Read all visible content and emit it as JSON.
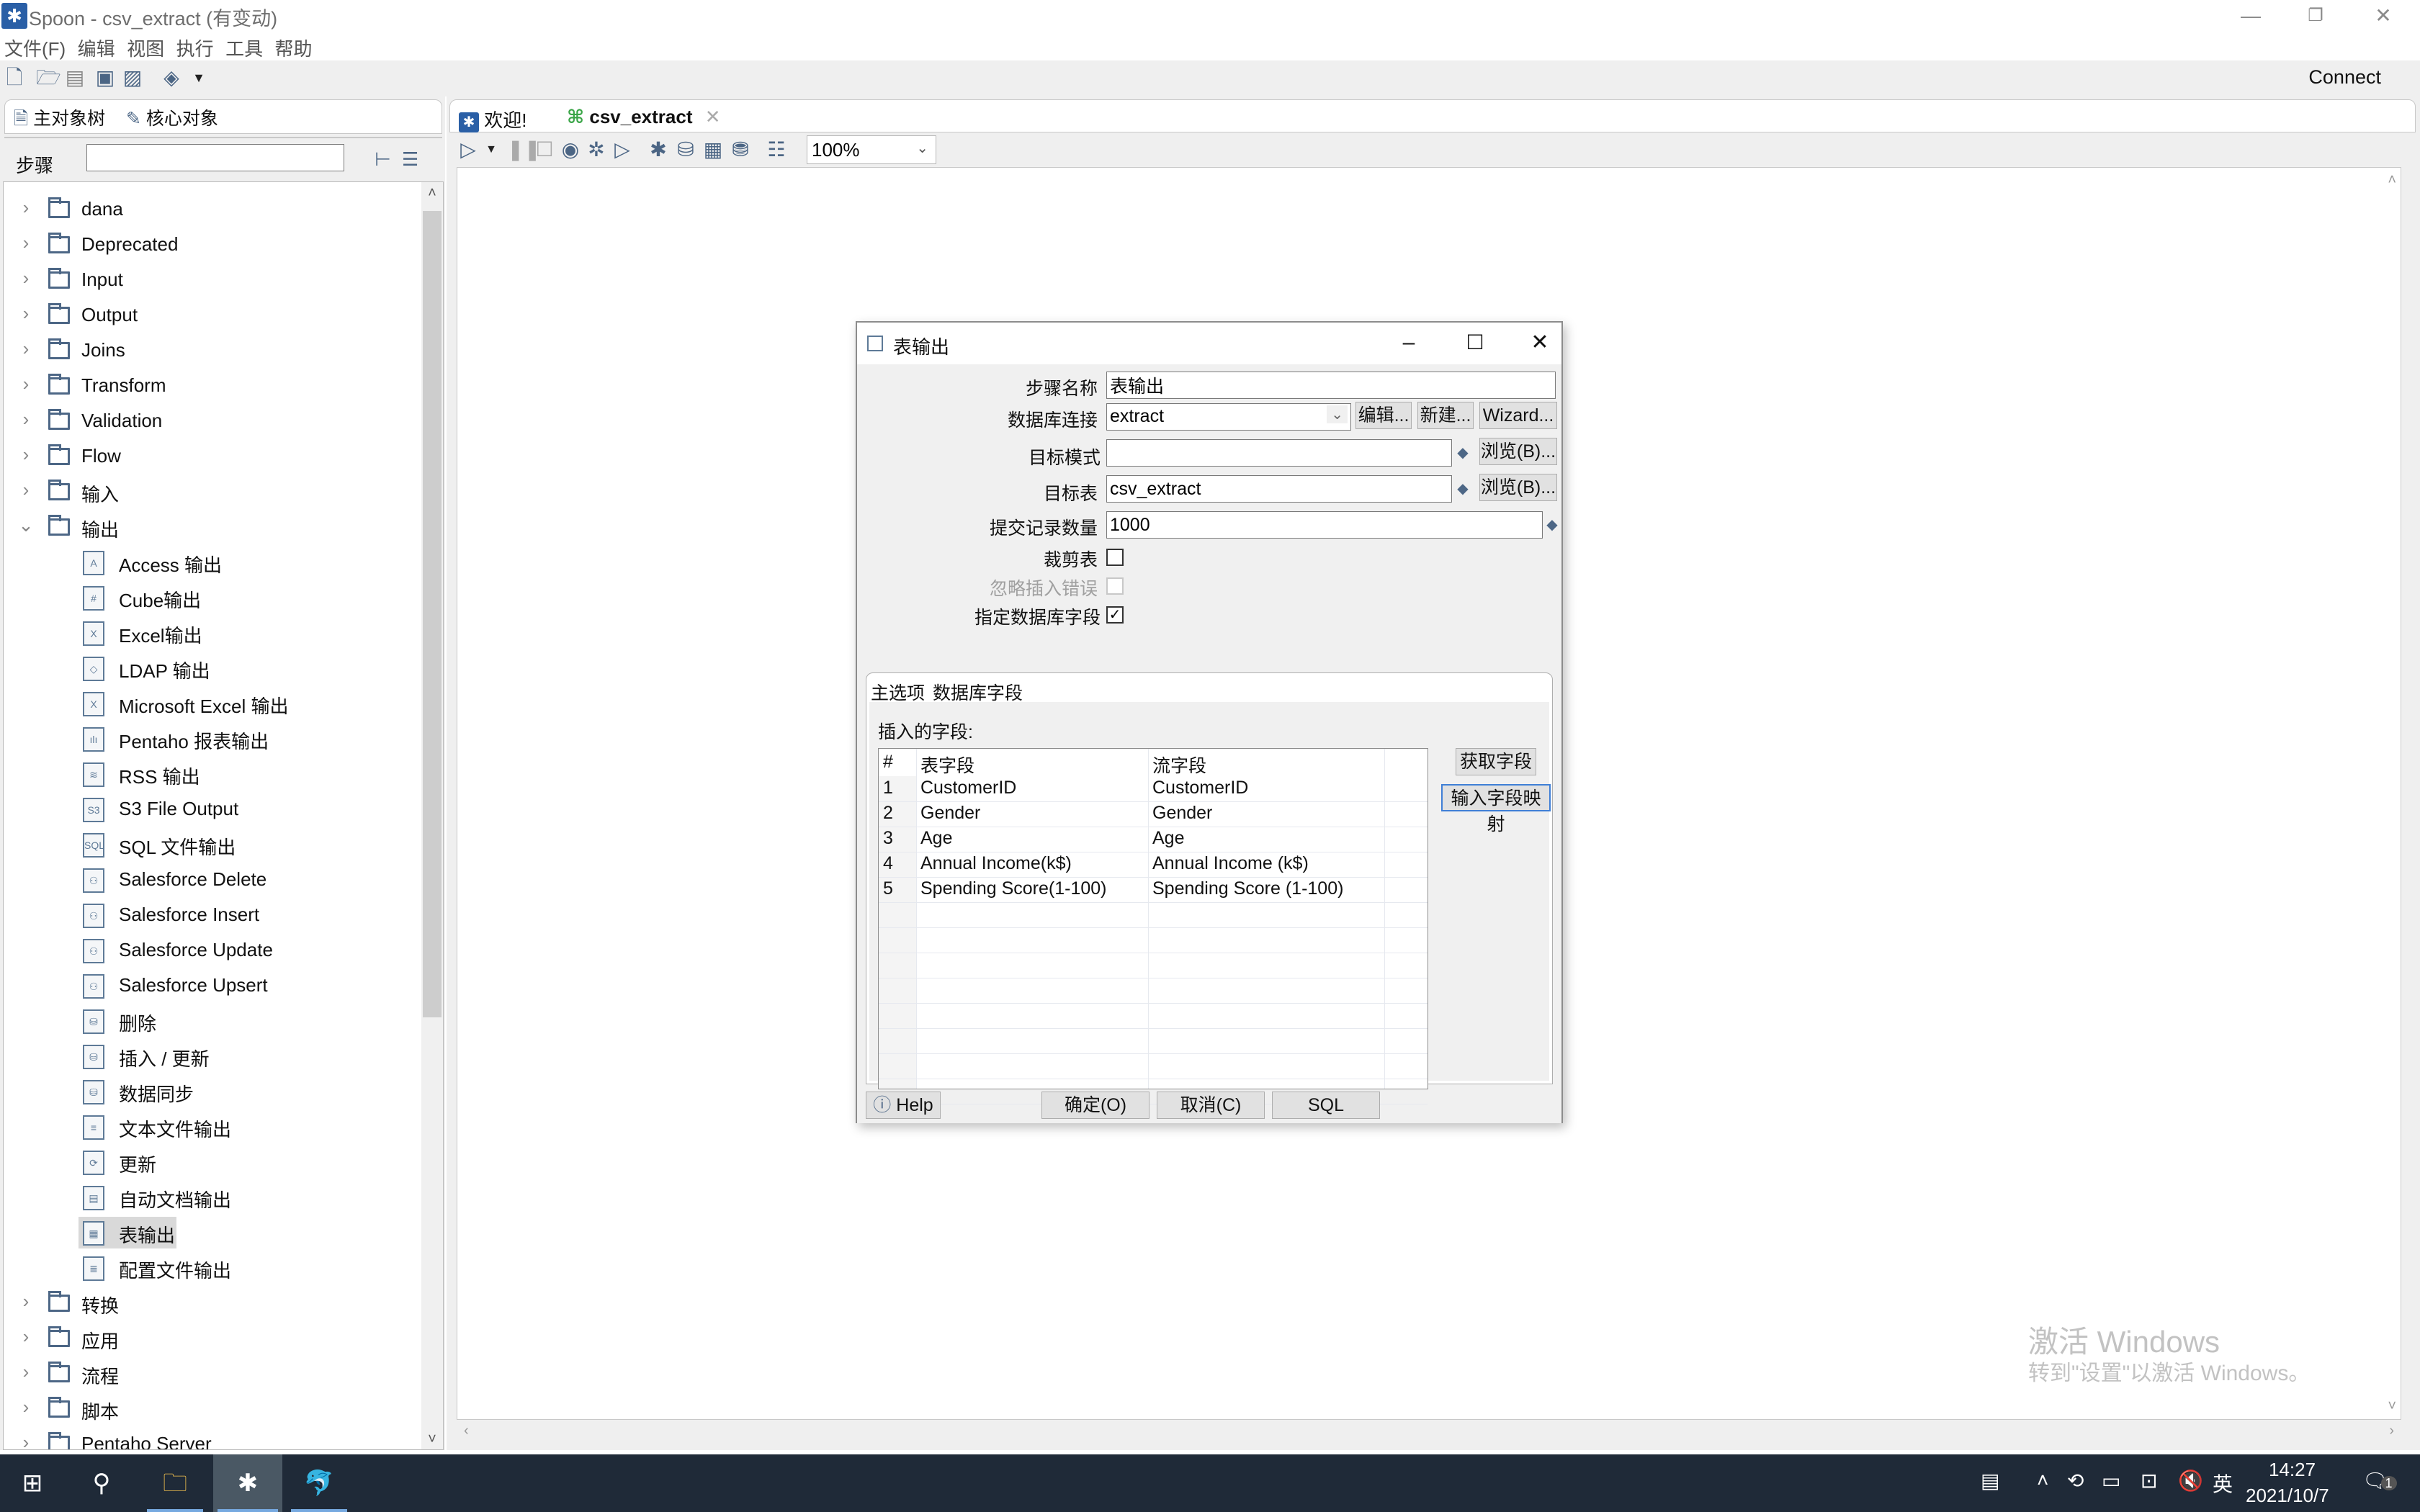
{
  "window": {
    "title": "Spoon - csv_extract (有变动)",
    "controls": {
      "minimize": "—",
      "restore": "❐",
      "close": "✕"
    }
  },
  "menu": [
    "文件(F)",
    "编辑",
    "视图",
    "执行",
    "工具",
    "帮助"
  ],
  "toolbar": {
    "icons": [
      "new-file-icon",
      "open-file-icon",
      "explore-repository-icon",
      "save-icon",
      "save-as-icon",
      "perspective-layers-icon"
    ],
    "connect_label": "Connect"
  },
  "left_panel": {
    "tabs": [
      {
        "label": "主对象树",
        "icon": "main-tree-icon"
      },
      {
        "label": "核心对象",
        "icon": "pencil-icon",
        "active": true
      }
    ],
    "steps_label": "步骤",
    "search_value": "",
    "tree": [
      {
        "label": "dana",
        "expanded": false
      },
      {
        "label": "Deprecated",
        "expanded": false
      },
      {
        "label": "Input",
        "expanded": false
      },
      {
        "label": "Output",
        "expanded": false
      },
      {
        "label": "Joins",
        "expanded": false
      },
      {
        "label": "Transform",
        "expanded": false
      },
      {
        "label": "Validation",
        "expanded": false
      },
      {
        "label": "Flow",
        "expanded": false
      },
      {
        "label": "输入",
        "expanded": false
      },
      {
        "label": "输出",
        "expanded": true
      }
    ],
    "output_children": [
      {
        "label": "Access 输出",
        "icon": "A"
      },
      {
        "label": "Cube输出",
        "icon": "#"
      },
      {
        "label": "Excel输出",
        "icon": "X"
      },
      {
        "label": "LDAP 输出",
        "icon": "◇"
      },
      {
        "label": "Microsoft Excel 输出",
        "icon": "X"
      },
      {
        "label": "Pentaho 报表输出",
        "icon": "ılı"
      },
      {
        "label": "RSS 输出",
        "icon": "≋"
      },
      {
        "label": "S3 File Output",
        "icon": "S3"
      },
      {
        "label": "SQL 文件输出",
        "icon": "SQL"
      },
      {
        "label": "Salesforce Delete",
        "icon": "⚇"
      },
      {
        "label": "Salesforce Insert",
        "icon": "⚇"
      },
      {
        "label": "Salesforce Update",
        "icon": "⚇"
      },
      {
        "label": "Salesforce Upsert",
        "icon": "⚇"
      },
      {
        "label": "删除",
        "icon": "⛁"
      },
      {
        "label": "插入 / 更新",
        "icon": "⛁"
      },
      {
        "label": "数据同步",
        "icon": "⛁"
      },
      {
        "label": "文本文件输出",
        "icon": "≡"
      },
      {
        "label": "更新",
        "icon": "⟳"
      },
      {
        "label": "自动文档输出",
        "icon": "▤"
      },
      {
        "label": "表输出",
        "icon": "▦",
        "selected": true
      },
      {
        "label": "配置文件输出",
        "icon": "≣"
      }
    ],
    "tree_after": [
      {
        "label": "转换",
        "expanded": false
      },
      {
        "label": "应用",
        "expanded": false
      },
      {
        "label": "流程",
        "expanded": false
      },
      {
        "label": "脚本",
        "expanded": false
      },
      {
        "label": "Pentaho Server",
        "expanded": false
      }
    ]
  },
  "editor": {
    "tabs": [
      {
        "label": "欢迎!",
        "icon": "spoon-icon"
      },
      {
        "label": "csv_extract",
        "icon": "transformation-icon",
        "active": true,
        "closable": true
      }
    ],
    "zoom": "100%",
    "watermark_title": "激活 Windows",
    "watermark_sub": "转到\"设置\"以激活 Windows。"
  },
  "dialog": {
    "title": "表输出",
    "fields": {
      "step_name_label": "步骤名称",
      "step_name_value": "表输出",
      "db_conn_label": "数据库连接",
      "db_conn_value": "extract",
      "edit_btn": "编辑...",
      "new_btn": "新建...",
      "wizard_btn": "Wizard...",
      "schema_label": "目标模式",
      "schema_value": "",
      "browse_btn": "浏览(B)...",
      "table_label": "目标表",
      "table_value": "csv_extract",
      "commit_label": "提交记录数量",
      "commit_value": "1000",
      "truncate_label": "裁剪表",
      "truncate_checked": false,
      "ignore_errors_label": "忽略插入错误",
      "ignore_errors_checked": false,
      "specify_fields_label": "指定数据库字段",
      "specify_fields_checked": true
    },
    "tabs": [
      {
        "label": "主选项"
      },
      {
        "label": "数据库字段",
        "active": true
      }
    ],
    "insert_fields_label": "插入的字段:",
    "table": {
      "headers": [
        "#",
        "表字段",
        "流字段"
      ],
      "rows": [
        [
          "1",
          "CustomerID",
          "CustomerID"
        ],
        [
          "2",
          "Gender",
          "Gender"
        ],
        [
          "3",
          "Age",
          "Age"
        ],
        [
          "4",
          "Annual Income(k$)",
          "Annual Income (k$)"
        ],
        [
          "5",
          "Spending Score(1-100)",
          "Spending Score (1-100)"
        ]
      ]
    },
    "get_fields_btn": "获取字段",
    "map_fields_btn": "输入字段映射",
    "help_btn": "Help",
    "ok_btn": "确定(O)",
    "cancel_btn": "取消(C)",
    "sql_btn": "SQL"
  },
  "taskbar": {
    "apps": [
      "start-icon",
      "search-icon",
      "file-explorer-icon",
      "spoon-icon",
      "mysql-dolphin-icon"
    ],
    "tray_lang": "英",
    "time": "14:27",
    "date": "2021/10/7",
    "notification_count": "1"
  }
}
